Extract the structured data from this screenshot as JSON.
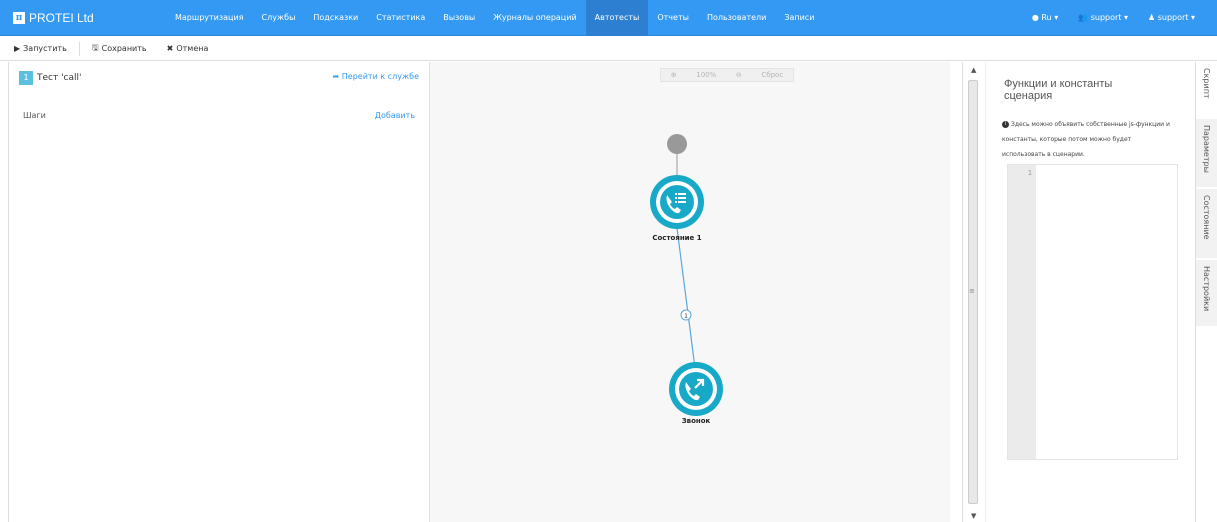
{
  "brand": {
    "name": "PROTEI Ltd",
    "logo_glyph": "π"
  },
  "nav": {
    "items": [
      {
        "label": "Маршрутизация"
      },
      {
        "label": "Службы"
      },
      {
        "label": "Подсказки"
      },
      {
        "label": "Статистика"
      },
      {
        "label": "Вызовы"
      },
      {
        "label": "Журналы операций"
      },
      {
        "label": "Автотесты",
        "active": true
      },
      {
        "label": "Отчеты"
      },
      {
        "label": "Пользователи"
      },
      {
        "label": "Записи"
      }
    ],
    "right": {
      "language": "Ru",
      "group": "support",
      "user": "support"
    }
  },
  "toolbar": {
    "run_label": "Запустить",
    "save_label": "Сохранить",
    "cancel_label": "Отмена"
  },
  "test": {
    "number": "1",
    "name": "Тест 'call'",
    "goto_label": "Перейти к службе",
    "steps_label": "Шаги",
    "add_label": "Добавить"
  },
  "canvas": {
    "zoom_level": "100%",
    "reset_label": "Сброс",
    "nodes": [
      {
        "label": "Состояние 1",
        "icon": "phone-list-icon"
      },
      {
        "label": "Звонок",
        "icon": "phone-outgoing-icon"
      }
    ],
    "edge_label": "1"
  },
  "right_panel": {
    "title": "Функции и константы сценария",
    "info_text": "Здесь можно объявить собственные js-функции и константы, которые потом можно будет использовать в сценарии.",
    "editor_line": "1"
  },
  "side_tabs": [
    {
      "label": "Скрипт",
      "active": true
    },
    {
      "label": "Параметры"
    },
    {
      "label": "Состояние"
    },
    {
      "label": "Настройки"
    }
  ],
  "colors": {
    "navbar": "#3399f3",
    "navbar_active": "#2c7fd1",
    "node": "#18a9c8",
    "start_node": "#999999",
    "edge": "#5aa8df"
  }
}
